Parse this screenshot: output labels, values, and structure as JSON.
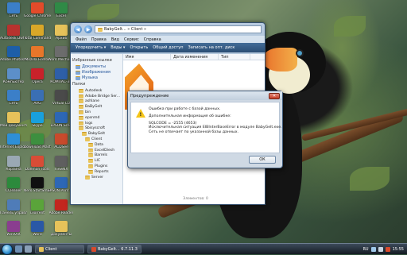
{
  "desktop": {
    "icons": [
      {
        "label": "Сеть",
        "color": "#3b7fc8"
      },
      {
        "label": "Autodesk Dwf Viewer",
        "color": "#b8322e"
      },
      {
        "label": "Adobe Photosh...",
        "color": "#1d5ea8"
      },
      {
        "label": "Компьютер",
        "color": "#5c8fc9"
      },
      {
        "label": "Сеть",
        "color": "#3b7fc8"
      },
      {
        "label": "Мои документы",
        "color": "#e6c25a"
      },
      {
        "label": "Internet Explorer",
        "color": "#2e8fd6"
      },
      {
        "label": "Корзина",
        "color": "#9aa8b4"
      },
      {
        "label": "CCleaner",
        "color": "#2c8a3c"
      },
      {
        "label": "Панель управления",
        "color": "#4f7cb8"
      },
      {
        "label": "WinRAR",
        "color": "#8a3e8f"
      },
      {
        "label": "Google Chrome",
        "color": "#e24b2a"
      },
      {
        "label": "Total Commander",
        "color": "#d9a728"
      },
      {
        "label": "Mozilla Firefox",
        "color": "#e7762a"
      },
      {
        "label": "Opera",
        "color": "#c8222a"
      },
      {
        "label": "AVG",
        "color": "#3a6fb4"
      },
      {
        "label": "Skype",
        "color": "#19a0dd"
      },
      {
        "label": "Download Master",
        "color": "#3d8f3f"
      },
      {
        "label": "Daemon Tools",
        "color": "#d84c36"
      },
      {
        "label": "Nero StartSmart",
        "color": "#101010"
      },
      {
        "label": "uTorrent",
        "color": "#5aa43a"
      },
      {
        "label": "Word",
        "color": "#2a58a6"
      },
      {
        "label": "Excel",
        "color": "#2f8a46"
      },
      {
        "label": "Архив",
        "color": "#e6c25a"
      },
      {
        "label": "Word Mechanic",
        "color": "#6c6c6c"
      },
      {
        "label": "КОМПАС-3D",
        "color": "#2e5fa8"
      },
      {
        "label": "Virtual CD",
        "color": "#4a4a4a"
      },
      {
        "label": "EPSON Scan",
        "color": "#2d67b5"
      },
      {
        "label": "ACDSee",
        "color": "#c84a2c"
      },
      {
        "label": "ViewNX",
        "color": "#5f5f5f"
      },
      {
        "label": "EPSON Print Panel",
        "color": "#2d67b5"
      },
      {
        "label": "Adobe Reader",
        "color": "#c2261e"
      },
      {
        "label": "Документы",
        "color": "#e6c25a"
      }
    ]
  },
  "explorer": {
    "address": "BabyGelt... » Client »",
    "menu": [
      "Файл",
      "Правка",
      "Вид",
      "Сервис",
      "Справка"
    ],
    "toolbar": [
      "Упорядочить ▾",
      "Виды ▾",
      "Открыть",
      "Общий доступ",
      "Записать на опт. диск"
    ],
    "nav_header": "Избранные ссылки",
    "nav_links": [
      "Документы",
      "Изображения",
      "Музыка"
    ],
    "folders_header": "Папки",
    "tree": [
      "Autodesk",
      "Adobe Bridge Ser...",
      "ashlane",
      "BaByGelt",
      "bin",
      "epsnmd",
      "logs",
      "Sbisyscroft",
      "BabyGelt",
      "Client",
      "Data",
      "ExcelDiesh",
      "Barrels",
      "LIC",
      "Plugins",
      "Reports",
      "Server"
    ],
    "columns": [
      "Имя",
      "Дата изменения",
      "Тип"
    ],
    "status": "Элементов: 0"
  },
  "dialog": {
    "title": "Предупреждение",
    "close_label": "✕",
    "lines": [
      "Ошибка при работе с базой данных.",
      "",
      "Дополнительная информация об ошибке:",
      "",
      "SQLCODE = -2555 (4653)",
      "Исключительная ситуация EIBInterBaseError в модуле BabyGelt.exe.",
      "Сеть не отвечает по указанной базы данных."
    ],
    "ok_label": "ОК"
  },
  "taskbar": {
    "buttons": [
      {
        "label": "Client",
        "color": "#e6c25a"
      },
      {
        "label": "BabyGelt...  6.7.11.3",
        "color": "#d94a2c"
      }
    ],
    "language": "RU",
    "clock": "15:55"
  }
}
